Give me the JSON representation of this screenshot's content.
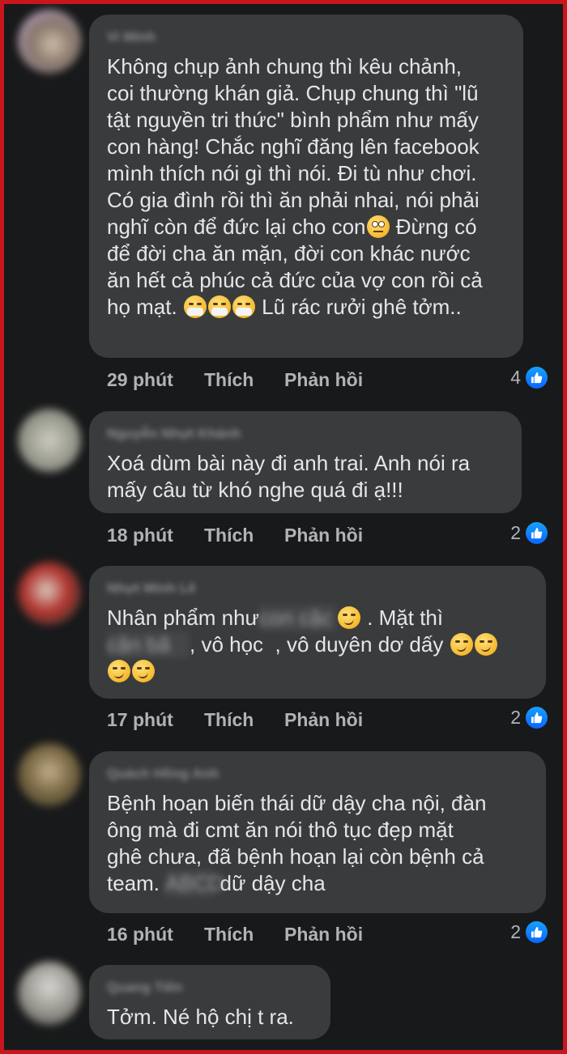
{
  "comments": [
    {
      "author": "Vi Minh",
      "lines": [
        "Không chụp ảnh chung thì kêu chảnh,",
        "coi thường khán giả. Chụp chung thì \"lũ",
        "tật nguyền tri thức\" bình phẩm như mấy",
        "con hàng! Chắc nghĩ đăng lên facebook",
        "mình thích nói gì thì nói. Đi tù như chơi.",
        "Có gia đình rồi thì ăn phải nhai, nói phải",
        "nghĩ còn để đức lại cho con",
        " Đừng có",
        "để đời cha ăn mặn, đời con khác nước",
        "ăn hết cả phúc cả đức của vợ con rồi cả",
        "họ mạt.",
        " Lũ rác rưởi ghê tởm.."
      ],
      "time": "29 phút",
      "like_label": "Thích",
      "reply_label": "Phản hồi",
      "reaction_count": "4"
    },
    {
      "author": "Nguyễn Nhựt Khánh",
      "lines": [
        "Xoá dùm bài này đi anh trai. Anh nói ra",
        "mấy câu từ khó nghe quá đi ạ!!!"
      ],
      "time": "18 phút",
      "like_label": "Thích",
      "reply_label": "Phản hồi",
      "reaction_count": "2"
    },
    {
      "author": "Nhựt Minh Lê",
      "text_a": "Nhân phẩm như",
      "redacted_a": "con cặc",
      "text_b": " . Mặt thì",
      "redacted_b": "cặn bã",
      "text_c": ", vô học  , vô duyên dơ dấy",
      "time": "17 phút",
      "like_label": "Thích",
      "reply_label": "Phản hồi",
      "reaction_count": "2"
    },
    {
      "author": "Quách Hồng Anh",
      "lines": [
        "Bệnh hoạn biến thái dữ dậy cha nội, đàn",
        "ông mà đi cmt ăn nói thô tục đẹp mặt",
        "ghê chưa, đã bệnh hoạn lại còn bệnh cả"
      ],
      "text_last_a": "team.",
      "redacted": "ABCD",
      "text_last_b": "dữ dậy cha",
      "time": "16 phút",
      "like_label": "Thích",
      "reply_label": "Phản hồi",
      "reaction_count": "2"
    },
    {
      "author": "Quang Tiến",
      "lines": [
        "Tởm. Né hộ chị t ra."
      ]
    }
  ],
  "colors": {
    "background": "#18191a",
    "bubble": "#3a3b3c",
    "frame": "#c8161d",
    "like_blue": "#0866ff"
  },
  "icons": [
    "avatar",
    "like-icon",
    "smirk-emoji",
    "mask-emoji",
    "eye-roll-emoji"
  ]
}
